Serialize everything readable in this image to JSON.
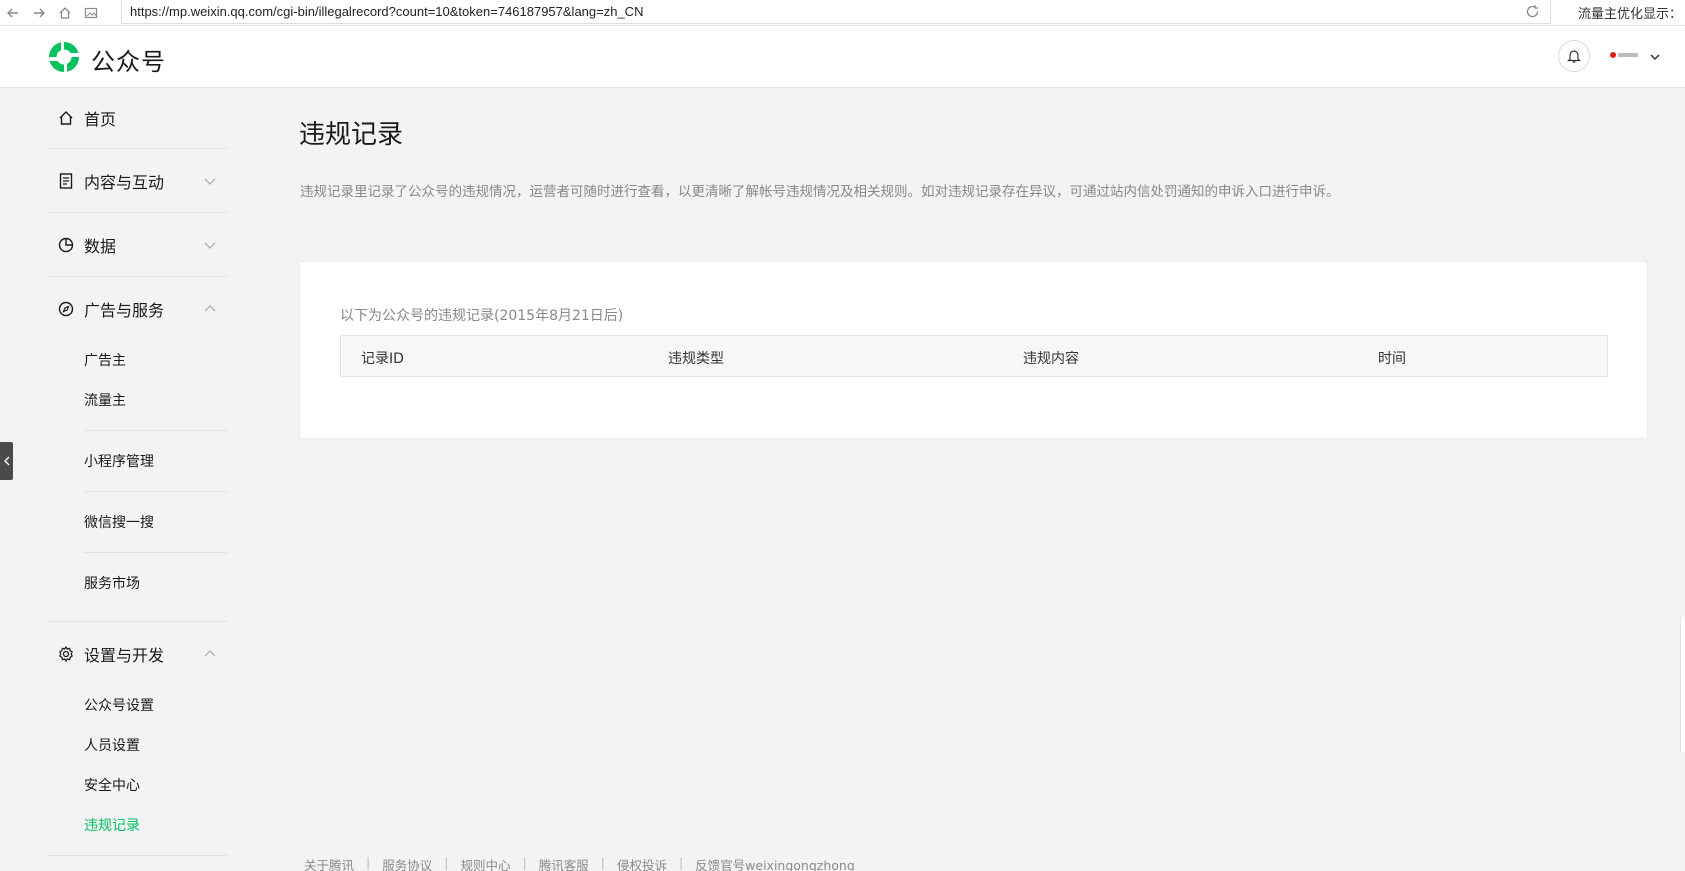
{
  "browser": {
    "url": "https://mp.weixin.qq.com/cgi-bin/illegalrecord?count=10&token=746187957&lang=zh_CN",
    "extension_text": "流量主优化显示："
  },
  "header": {
    "brand": "公众号"
  },
  "sidebar": {
    "home": "首页",
    "content": "内容与互动",
    "data": "数据",
    "ads": "广告与服务",
    "ads_items": [
      "广告主",
      "流量主"
    ],
    "mini_program": "小程序管理",
    "search": "微信搜一搜",
    "market": "服务市场",
    "settings": "设置与开发",
    "settings_items": [
      "公众号设置",
      "人员设置",
      "安全中心",
      "违规记录"
    ]
  },
  "main": {
    "title": "违规记录",
    "description": "违规记录里记录了公众号的违规情况，运营者可随时进行查看，以更清晰了解帐号违规情况及相关规则。如对违规记录存在异议，可通过站内信处罚通知的申诉入口进行申诉。",
    "caption": "以下为公众号的违规记录(2015年8月21日后)",
    "columns": [
      "记录ID",
      "违规类型",
      "违规内容",
      "时间"
    ]
  },
  "footer": {
    "links": [
      "关于腾讯",
      "服务协议",
      "规则中心",
      "腾讯客服",
      "侵权投诉",
      "反馈官号weixingongzhong"
    ],
    "separator": "|"
  },
  "colors": {
    "accent": "#07c160",
    "background": "#f2f3f5"
  },
  "icons": {
    "logo": "wechat-mp-logo",
    "bell": "bell-icon",
    "home": "home-icon"
  }
}
